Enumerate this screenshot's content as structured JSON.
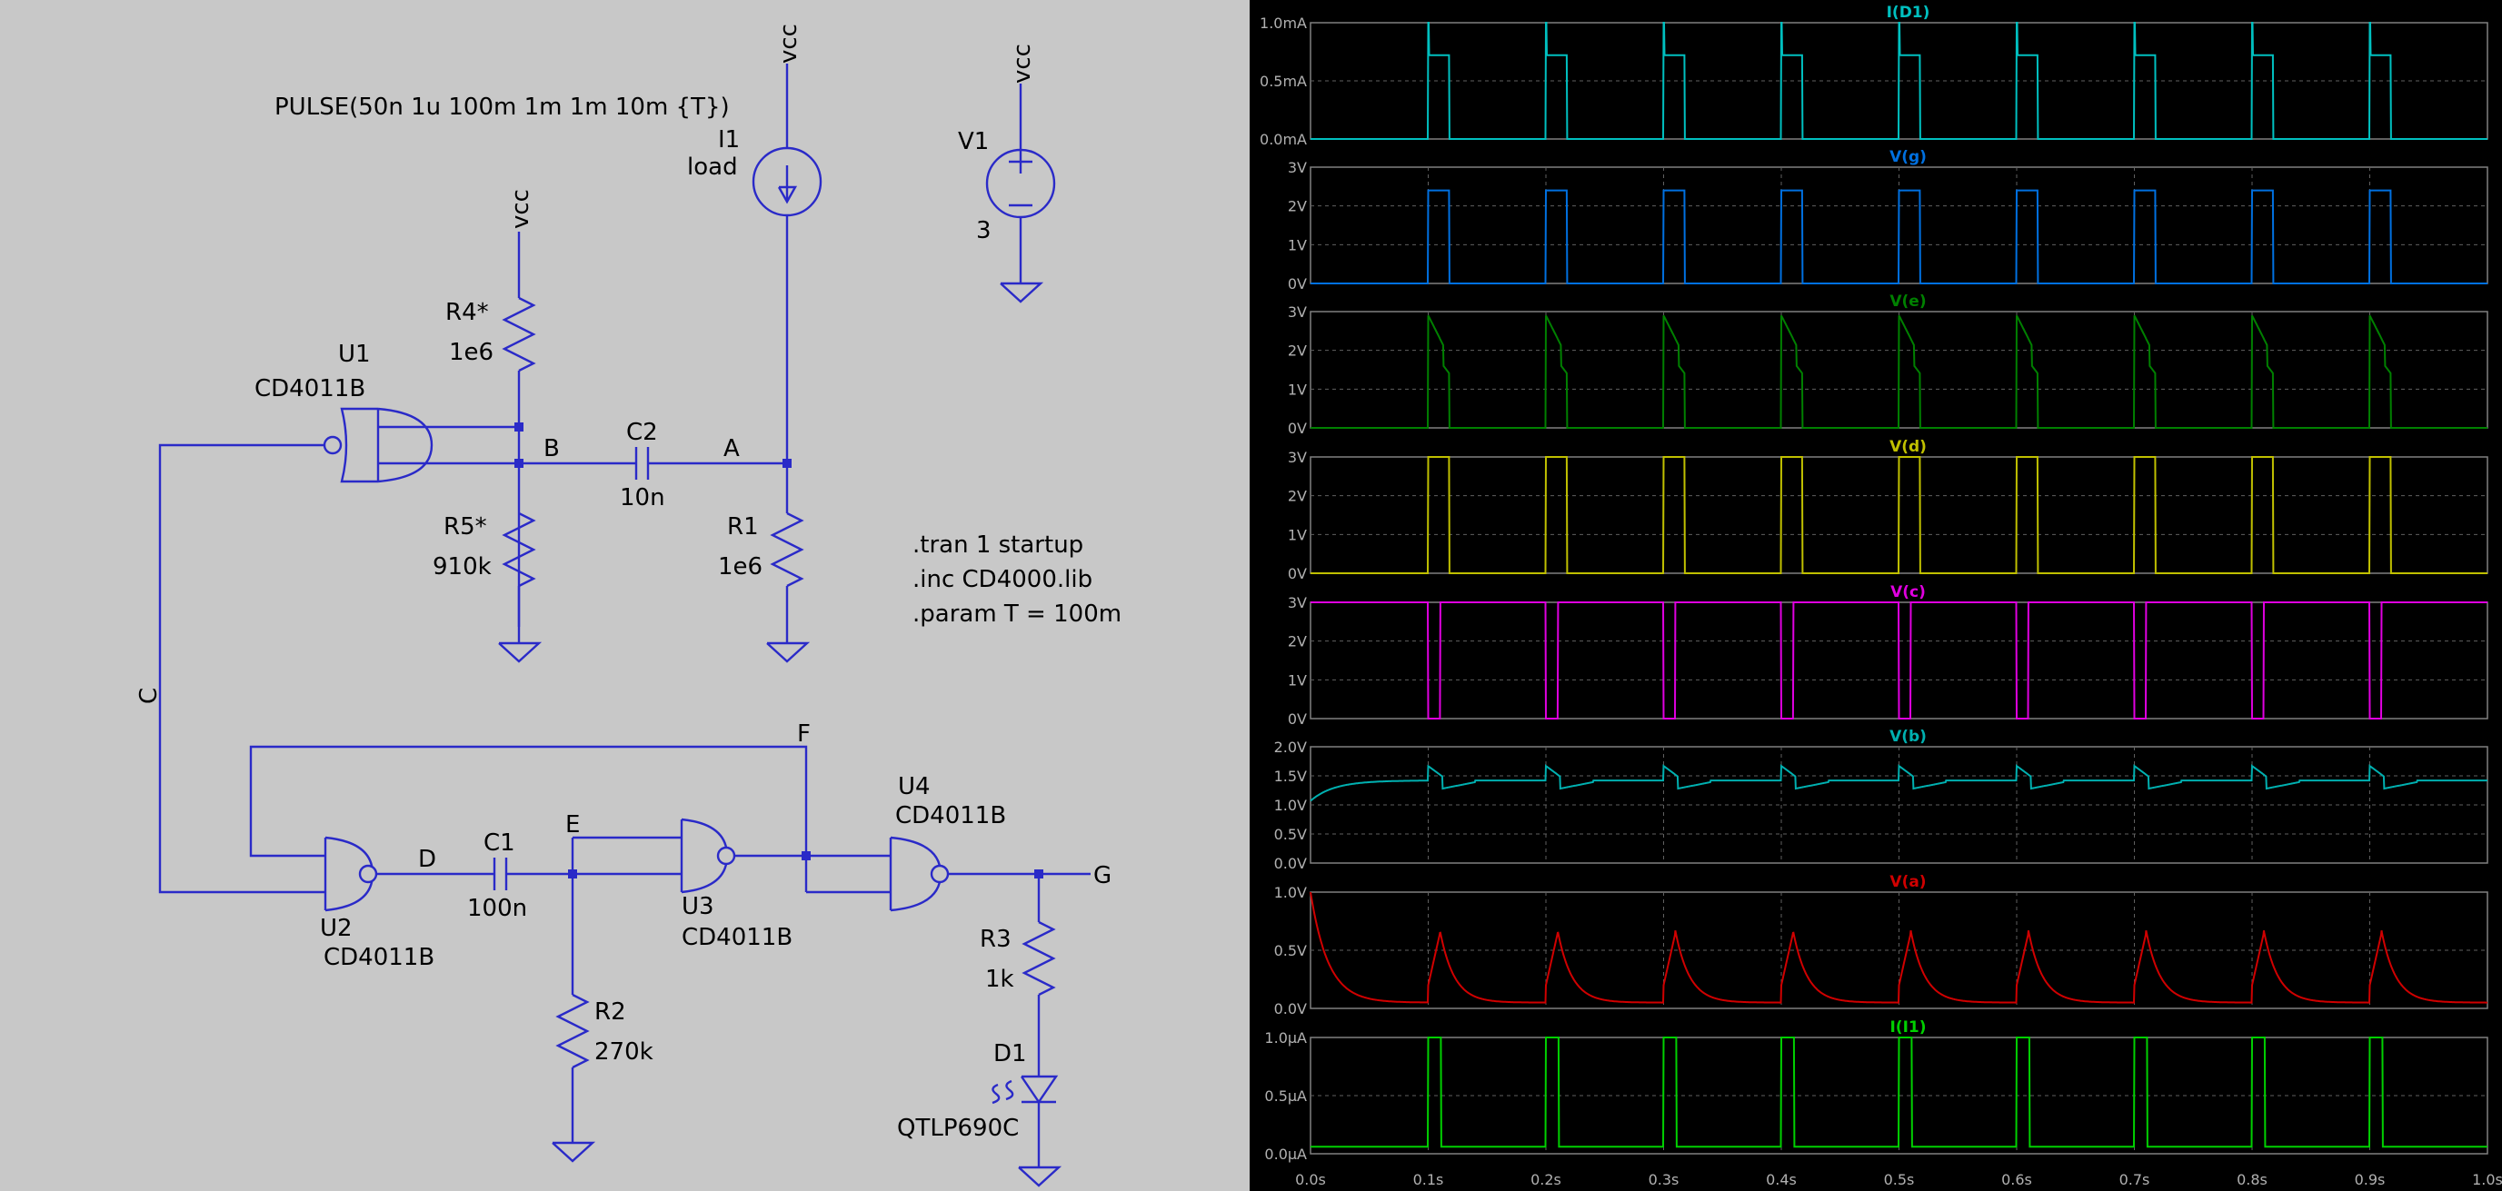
{
  "schematic": {
    "labels": {
      "pulse": "PULSE(50n 1u 100m 1m 1m 10m {T})",
      "i1": "I1",
      "load": "load",
      "vcc": "vcc",
      "v1": "V1",
      "v1_value": "3",
      "r4": "R4*",
      "r4_value": "1e6",
      "u1": "U1",
      "u1_part": "CD4011B",
      "node_b": "B",
      "c2": "C2",
      "c2_value": "10n",
      "node_a": "A",
      "r5": "R5*",
      "r5_value": "910k",
      "r1": "R1",
      "r1_value": "1e6",
      "directive_tran": ".tran 1 startup",
      "directive_inc": ".inc CD4000.lib",
      "directive_param": ".param T = 100m",
      "node_c": "C",
      "node_f": "F",
      "u4": "U4",
      "u4_part": "CD4011B",
      "node_d": "D",
      "c1": "C1",
      "c1_value": "100n",
      "node_e": "E",
      "node_g": "G",
      "u2": "U2",
      "u2_part": "CD4011B",
      "u3": "U3",
      "u3_part": "CD4011B",
      "r3": "R3",
      "r3_value": "1k",
      "r2": "R2",
      "r2_value": "270k",
      "d1": "D1",
      "d1_part": "QTLP690C"
    }
  },
  "chart_data": {
    "type": "line",
    "x_ticks": [
      "0.0s",
      "0.1s",
      "0.2s",
      "0.3s",
      "0.4s",
      "0.5s",
      "0.6s",
      "0.7s",
      "0.8s",
      "0.9s",
      "1.0s"
    ],
    "xlim": [
      0,
      1
    ],
    "pulse_starts": [
      0.1,
      0.2,
      0.3,
      0.4,
      0.5,
      0.6,
      0.7,
      0.8,
      0.9
    ],
    "panels": [
      {
        "name": "I(D1)",
        "color": "#00c0c0",
        "kind": "led",
        "ylim": [
          0,
          1
        ],
        "ticks": [
          "1.0mA",
          "0.5mA",
          "0.0mA"
        ],
        "tick_vals": [
          1,
          0.5,
          0
        ]
      },
      {
        "name": "V(g)",
        "color": "#0070e0",
        "kind": "g",
        "ylim": [
          0,
          3
        ],
        "ticks": [
          "3V",
          "2V",
          "1V",
          "0V"
        ],
        "tick_vals": [
          3,
          2,
          1,
          0
        ]
      },
      {
        "name": "V(e)",
        "color": "#008000",
        "kind": "e",
        "ylim": [
          0,
          3
        ],
        "ticks": [
          "3V",
          "2V",
          "1V",
          "0V"
        ],
        "tick_vals": [
          3,
          2,
          1,
          0
        ]
      },
      {
        "name": "V(d)",
        "color": "#c0c000",
        "kind": "d",
        "ylim": [
          0,
          3
        ],
        "ticks": [
          "3V",
          "2V",
          "1V",
          "0V"
        ],
        "tick_vals": [
          3,
          2,
          1,
          0
        ]
      },
      {
        "name": "V(c)",
        "color": "#e000e0",
        "kind": "c",
        "ylim": [
          0,
          3
        ],
        "ticks": [
          "3V",
          "2V",
          "1V",
          "0V"
        ],
        "tick_vals": [
          3,
          2,
          1,
          0
        ]
      },
      {
        "name": "V(b)",
        "color": "#00b0b0",
        "kind": "b",
        "ylim": [
          0,
          2
        ],
        "ticks": [
          "2.0V",
          "1.5V",
          "1.0V",
          "0.5V",
          "0.0V"
        ],
        "tick_vals": [
          2,
          1.5,
          1,
          0.5,
          0
        ]
      },
      {
        "name": "V(a)",
        "color": "#d00000",
        "kind": "a",
        "ylim": [
          0,
          1
        ],
        "ticks": [
          "1.0V",
          "0.5V",
          "0.0V"
        ],
        "tick_vals": [
          1,
          0.5,
          0
        ]
      },
      {
        "name": "I(I1)",
        "color": "#00d000",
        "kind": "i1",
        "ylim": [
          0,
          1
        ],
        "ticks": [
          "1.0µA",
          "0.5µA",
          "0.0µA"
        ],
        "tick_vals": [
          1,
          0.5,
          0
        ]
      }
    ]
  }
}
